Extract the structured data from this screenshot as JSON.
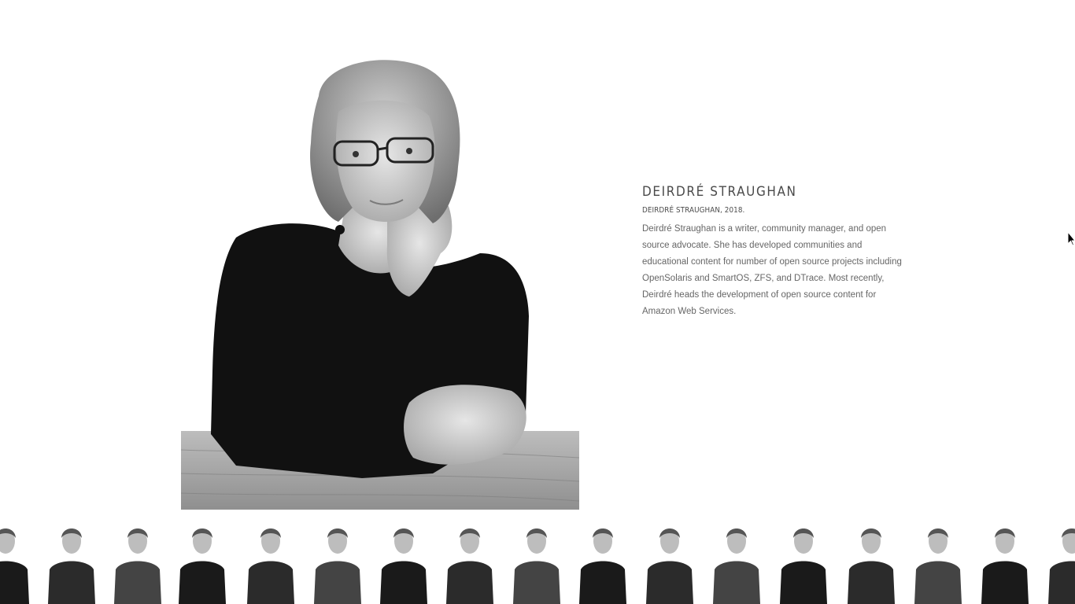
{
  "featured": {
    "name": "DEIRDRÉ STRAUGHAN",
    "caption": "DEIRDRÉ STRAUGHAN, 2018.",
    "bio": "Deirdré Straughan is a writer, community manager, and open source advocate. She has developed communities and educational content for number of open source projects including OpenSolaris and SmartOS, ZFS, and DTrace. Most recently, Deirdré heads the development of open source content for Amazon Web Services."
  },
  "thumbnails": [
    {
      "name": "thumb-portrait-1"
    },
    {
      "name": "thumb-portrait-2"
    },
    {
      "name": "thumb-portrait-3"
    },
    {
      "name": "thumb-portrait-4"
    },
    {
      "name": "thumb-portrait-5"
    },
    {
      "name": "thumb-portrait-6"
    },
    {
      "name": "thumb-portrait-7"
    },
    {
      "name": "thumb-portrait-8"
    },
    {
      "name": "thumb-portrait-9"
    },
    {
      "name": "thumb-portrait-10"
    },
    {
      "name": "thumb-portrait-11"
    },
    {
      "name": "thumb-portrait-12"
    },
    {
      "name": "thumb-portrait-13"
    },
    {
      "name": "thumb-portrait-14"
    },
    {
      "name": "thumb-portrait-15"
    },
    {
      "name": "thumb-portrait-16"
    },
    {
      "name": "thumb-portrait-17"
    }
  ]
}
